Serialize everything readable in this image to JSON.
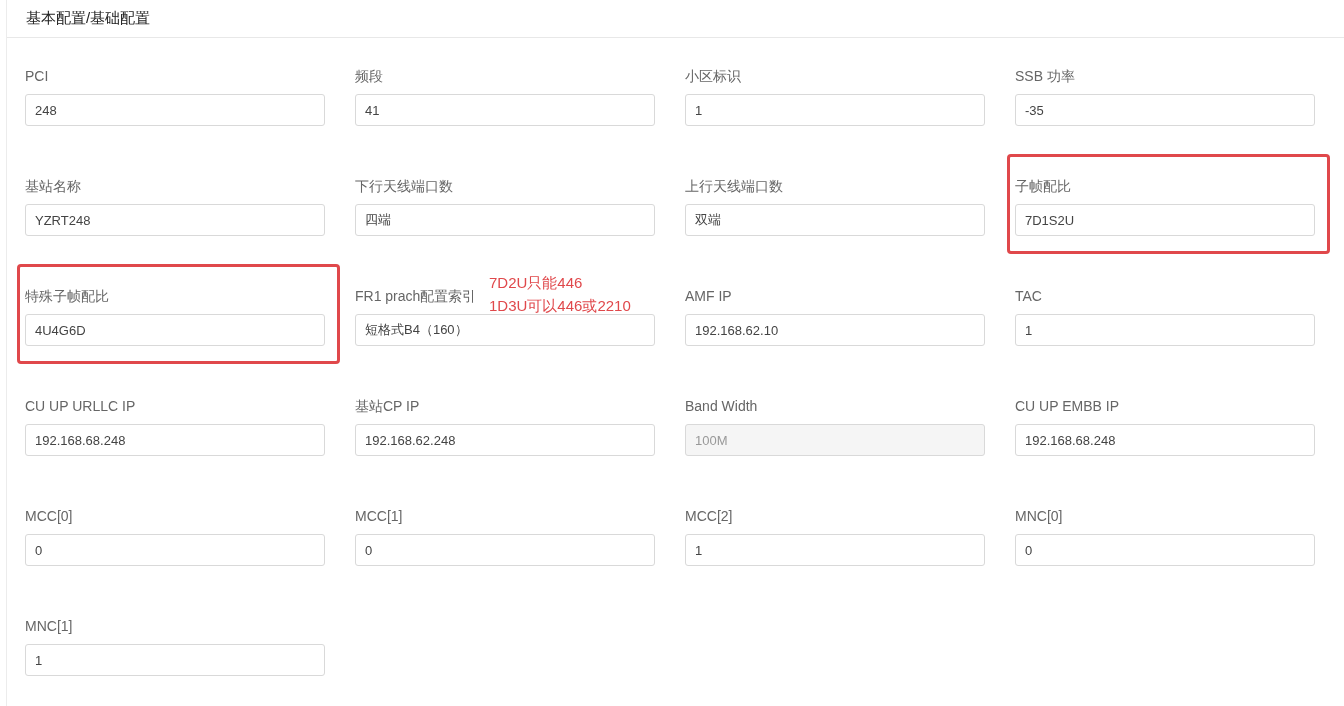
{
  "panel": {
    "title": "基本配置/基础配置"
  },
  "fields": [
    {
      "label": "PCI",
      "value": "248",
      "disabled": false,
      "highlighted": false
    },
    {
      "label": "频段",
      "value": "41",
      "disabled": false,
      "highlighted": false
    },
    {
      "label": "小区标识",
      "value": "1",
      "disabled": false,
      "highlighted": false
    },
    {
      "label": "SSB 功率",
      "value": "-35",
      "disabled": false,
      "highlighted": false
    },
    {
      "label": "基站名称",
      "value": "YZRT248",
      "disabled": false,
      "highlighted": false
    },
    {
      "label": "下行天线端口数",
      "value": "四端",
      "disabled": false,
      "highlighted": false
    },
    {
      "label": "上行天线端口数",
      "value": "双端",
      "disabled": false,
      "highlighted": false
    },
    {
      "label": "子帧配比",
      "value": "7D1S2U",
      "disabled": false,
      "highlighted": true
    },
    {
      "label": "特殊子帧配比",
      "value": "4U4G6D",
      "disabled": false,
      "highlighted": true
    },
    {
      "label": "FR1 prach配置索引",
      "value": "短格式B4（160）",
      "disabled": false,
      "highlighted": false,
      "annotation": [
        "7D2U只能446",
        "1D3U可以446或2210"
      ]
    },
    {
      "label": "AMF IP",
      "value": "192.168.62.10",
      "disabled": false,
      "highlighted": false
    },
    {
      "label": "TAC",
      "value": "1",
      "disabled": false,
      "highlighted": false
    },
    {
      "label": "CU UP URLLC IP",
      "value": "192.168.68.248",
      "disabled": false,
      "highlighted": false
    },
    {
      "label": "基站CP IP",
      "value": "192.168.62.248",
      "disabled": false,
      "highlighted": false
    },
    {
      "label": "Band Width",
      "value": "100M",
      "disabled": true,
      "highlighted": false
    },
    {
      "label": "CU UP EMBB IP",
      "value": "192.168.68.248",
      "disabled": false,
      "highlighted": false
    },
    {
      "label": "MCC[0]",
      "value": "0",
      "disabled": false,
      "highlighted": false
    },
    {
      "label": "MCC[1]",
      "value": "0",
      "disabled": false,
      "highlighted": false
    },
    {
      "label": "MCC[2]",
      "value": "1",
      "disabled": false,
      "highlighted": false
    },
    {
      "label": "MNC[0]",
      "value": "0",
      "disabled": false,
      "highlighted": false
    },
    {
      "label": "MNC[1]",
      "value": "1",
      "disabled": false,
      "highlighted": false
    }
  ]
}
